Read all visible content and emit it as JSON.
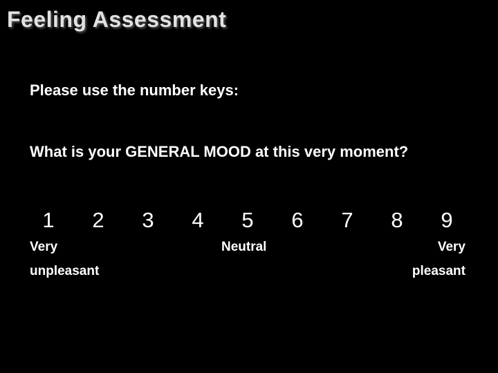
{
  "title": "Feeling Assessment",
  "instruction": "Please use the number keys:",
  "question": "What is your GENERAL MOOD at this very moment?",
  "scale": {
    "values": [
      "1",
      "2",
      "3",
      "4",
      "5",
      "6",
      "7",
      "8",
      "9"
    ]
  },
  "anchors": {
    "left": {
      "line1": "Very",
      "line2": "unpleasant"
    },
    "middle": "Neutral",
    "right": {
      "line1": "Very",
      "line2": "pleasant"
    }
  }
}
